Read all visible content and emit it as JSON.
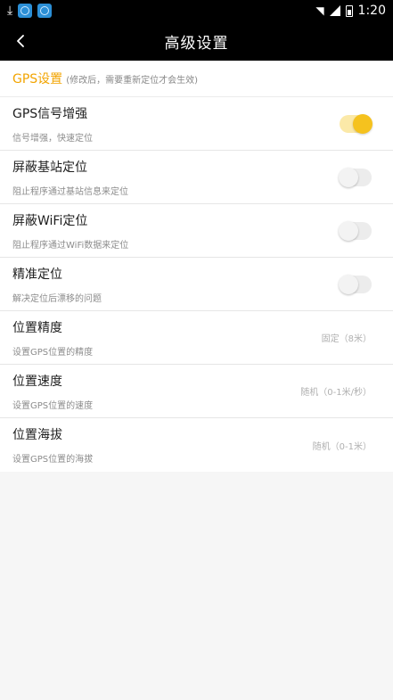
{
  "status_bar": {
    "time": "1:20"
  },
  "app_bar": {
    "title": "高级设置"
  },
  "section": {
    "title": "GPS设置",
    "note": "(修改后，需要重新定位才会生效)"
  },
  "settings": [
    {
      "title": "GPS信号增强",
      "desc": "信号增强，快速定位",
      "type": "toggle",
      "on": true
    },
    {
      "title": "屏蔽基站定位",
      "desc": "阻止程序通过基站信息来定位",
      "type": "toggle",
      "on": false
    },
    {
      "title": "屏蔽WiFi定位",
      "desc": "阻止程序通过WiFi数据来定位",
      "type": "toggle",
      "on": false
    },
    {
      "title": "精准定位",
      "desc": "解决定位后漂移的问题",
      "type": "toggle",
      "on": false
    },
    {
      "title": "位置精度",
      "desc": "设置GPS位置的精度",
      "type": "value",
      "value": "固定（8米）"
    },
    {
      "title": "位置速度",
      "desc": "设置GPS位置的速度",
      "type": "value",
      "value": "随机（0-1米/秒）"
    },
    {
      "title": "位置海拔",
      "desc": "设置GPS位置的海拔",
      "type": "value",
      "value": "随机（0-1米）"
    }
  ],
  "colors": {
    "accent": "#f2a400",
    "toggle_on": "#f5c21e",
    "app_bar": "#000000"
  },
  "icons": [
    "download-icon",
    "app-icon",
    "wifi-icon",
    "signal-icon",
    "battery-icon",
    "back-arrow-icon"
  ]
}
